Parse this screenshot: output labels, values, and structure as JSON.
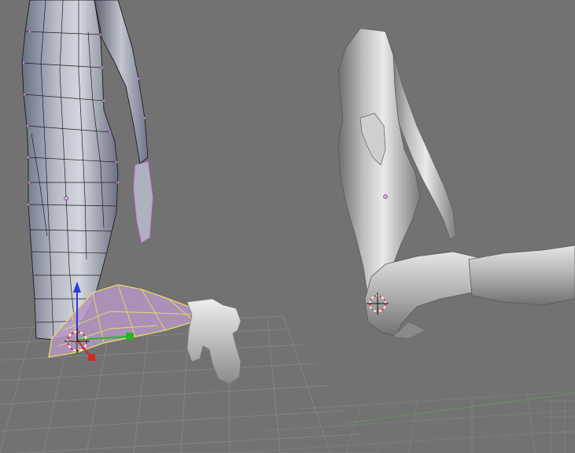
{
  "app": {
    "kind": "3d-modeling-viewports",
    "visible_text": []
  },
  "colors": {
    "background": "#727272",
    "grid_line": "#8a8a8a",
    "grid_axis_green": "#5aa860",
    "mesh_fill_dark": "#6a6f80",
    "mesh_fill_light": "#c9ccd6",
    "mesh_wire": "#1c1e24",
    "mesh_vertex": "#d37be0",
    "selected_face": "#b596c3",
    "selected_edge": "#e6dc62",
    "shaded_light": "#e8e8e8",
    "shaded_dark": "#6d6d6d",
    "manip_z": "#2c3bd6",
    "manip_x": "#d62626",
    "manip_y": "#26b526"
  },
  "viewports": [
    {
      "id": "left",
      "content": "wireframe-edit-mode-figure-kneeling",
      "cursor": "3d-cursor-icon",
      "manipulator": "transform-manipulator"
    },
    {
      "id": "right",
      "content": "solid-shaded-figure-kneeling",
      "cursor": "3d-cursor-icon"
    }
  ]
}
